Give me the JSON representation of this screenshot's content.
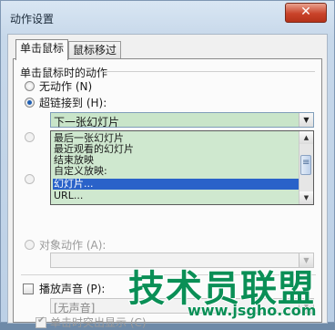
{
  "window": {
    "title": "动作设置",
    "close_glyph": "✕"
  },
  "tabs": [
    {
      "label": "单击鼠标"
    },
    {
      "label": "鼠标移过"
    }
  ],
  "section": {
    "label": "单击鼠标时的动作"
  },
  "options": {
    "no_action": "无动作 (N)",
    "hyperlink": "超链接到 (H):",
    "object_action": "对象动作 (A):"
  },
  "hyperlink_combo": {
    "value": "下一张幻灯片"
  },
  "dropdown_items": [
    "最后一张幻灯片",
    "最近观看的幻灯片",
    "结束放映",
    "自定义放映:",
    "幻灯片...",
    "URL..."
  ],
  "selected_dropdown_index": 4,
  "sound": {
    "label": "播放声音 (P):",
    "value": "[无声音]"
  },
  "highlight": {
    "label": "单击时突出显示 (C)"
  },
  "watermark": {
    "text": "技术员联盟",
    "url": "www.jsgho.com"
  },
  "icons": {
    "dropdown_arrow": "▼",
    "scroll_up": "▲",
    "scroll_down": "▼",
    "thumb_grip": "≡"
  }
}
